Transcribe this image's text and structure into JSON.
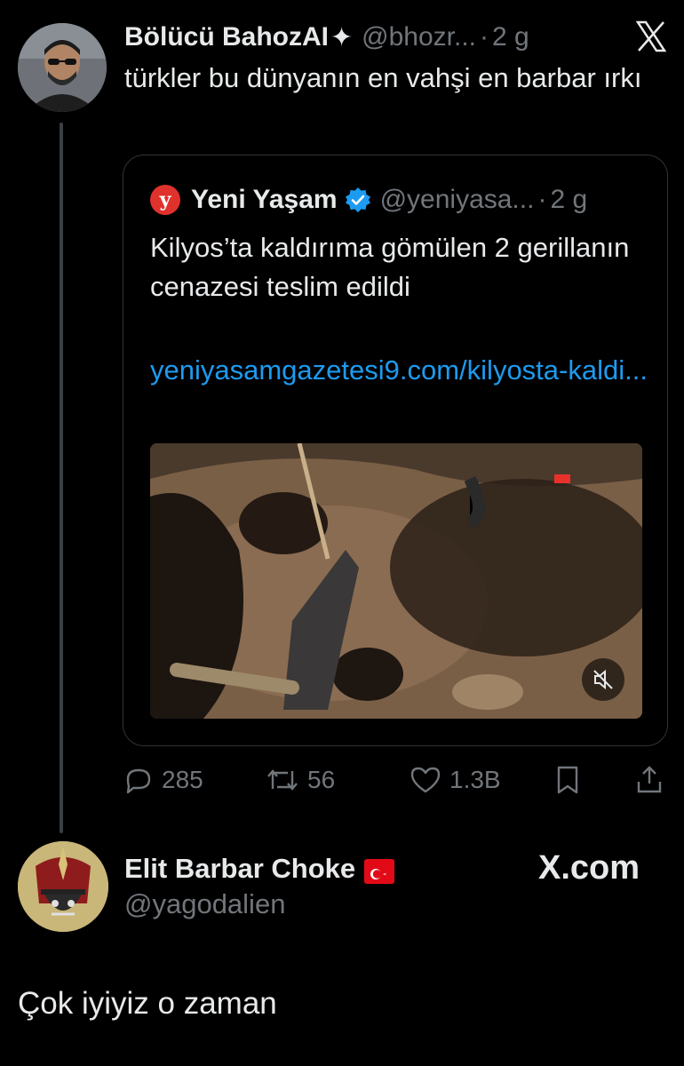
{
  "tweet": {
    "author_name": "Bölücü BahozAI",
    "author_name_suffix": "✦",
    "handle": "@bhozr...",
    "time": "2 g",
    "text": "türkler bu dünyanın en vahşi en barbar ırkı"
  },
  "quote": {
    "logo_letter": "y",
    "author_name": "Yeni Yaşam",
    "handle": "@yeniyasa...",
    "time": "2 g",
    "text": "Kilyos’ta kaldırıma gömülen 2 gerillanın cenazesi teslim edildi",
    "link": "yeniyasamgazetesi9.com/kilyosta-kaldi..."
  },
  "actions": {
    "replies": "285",
    "reposts": "56",
    "likes": "1.3B"
  },
  "reply": {
    "author_name": "Elit Barbar Choke",
    "handle": "@yagodalien",
    "watermark": "X.com",
    "text": "Çok iyiyiz o zaman"
  },
  "icons": {
    "close": "close-x-icon",
    "verified": "verified-badge-icon",
    "mute": "muted-speaker-icon",
    "reply": "reply-icon",
    "repost": "repost-icon",
    "like": "heart-icon",
    "bookmark": "bookmark-icon",
    "share": "share-icon"
  },
  "colors": {
    "background": "#000000",
    "text": "#e7e9ea",
    "muted": "#71767b",
    "link": "#1d9bf0",
    "border": "#2f3336",
    "logo_red": "#e0322c"
  }
}
